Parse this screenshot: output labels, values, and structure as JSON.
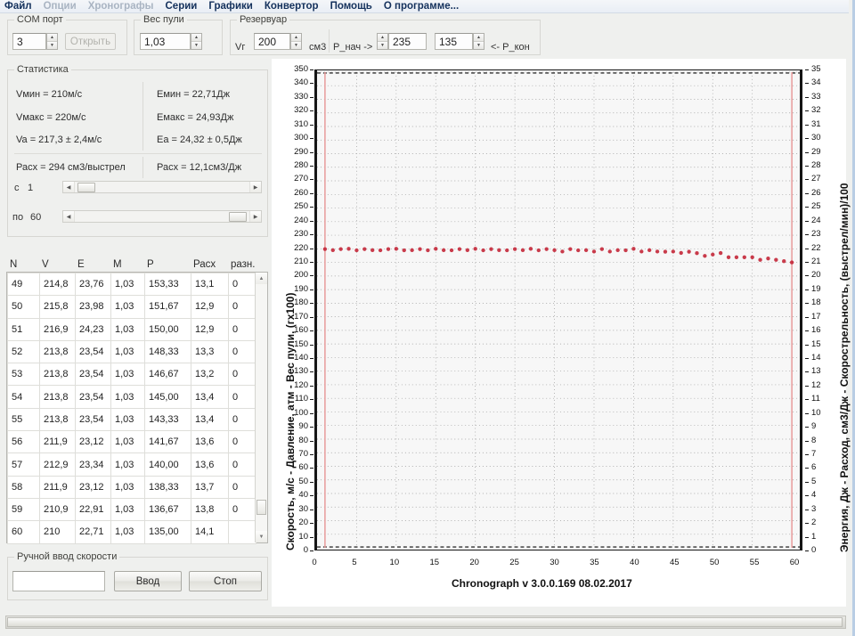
{
  "menu": {
    "items": [
      {
        "label": "Файл",
        "disabled": false
      },
      {
        "label": "Опции",
        "disabled": true
      },
      {
        "label": "Хронографы",
        "disabled": true
      },
      {
        "label": "Серии",
        "disabled": false
      },
      {
        "label": "Графики",
        "disabled": false
      },
      {
        "label": "Конвертор",
        "disabled": false
      },
      {
        "label": "Помощь",
        "disabled": false
      },
      {
        "label": "О программе...",
        "disabled": false
      }
    ]
  },
  "toolbar": {
    "com_group_label": "COM порт",
    "com_value": "3",
    "open_button": "Открыть",
    "bullet_group_label": "Вес пули",
    "bullet_value": "1,03",
    "reservoir_group_label": "Резервуар",
    "vg_label": "Vг",
    "vg_value": "200",
    "vg_units": "см3",
    "p_start_label": "P_нач ->",
    "p_start_value": "235",
    "p_end_value": "135",
    "p_end_label": "<- P_кон"
  },
  "statistics": {
    "group_label": "Статистика",
    "v_min": "Vмин = 210м/с",
    "v_max": "Vмакс = 220м/с",
    "v_avg": "Va = 217,3 ± 2,4м/с",
    "e_min": "Eмин = 22,71Дж",
    "e_max": "Eмакс = 24,93Дж",
    "e_avg": "Ea = 24,32 ± 0,5Дж",
    "rash_shot": "Расх = 294 см3/выстрел",
    "rash_joule": "Расх = 12,1см3/Дж",
    "from_label": "с",
    "from_value": "1",
    "to_label": "по",
    "to_value": "60"
  },
  "table": {
    "headers": [
      "N",
      "V",
      "E",
      "M",
      "P",
      "Расх",
      "разн."
    ],
    "rows": [
      [
        "49",
        "214,8",
        "23,76",
        "1,03",
        "153,33",
        "13,1",
        "0"
      ],
      [
        "50",
        "215,8",
        "23,98",
        "1,03",
        "151,67",
        "12,9",
        "0"
      ],
      [
        "51",
        "216,9",
        "24,23",
        "1,03",
        "150,00",
        "12,9",
        "0"
      ],
      [
        "52",
        "213,8",
        "23,54",
        "1,03",
        "148,33",
        "13,3",
        "0"
      ],
      [
        "53",
        "213,8",
        "23,54",
        "1,03",
        "146,67",
        "13,2",
        "0"
      ],
      [
        "54",
        "213,8",
        "23,54",
        "1,03",
        "145,00",
        "13,4",
        "0"
      ],
      [
        "55",
        "213,8",
        "23,54",
        "1,03",
        "143,33",
        "13,4",
        "0"
      ],
      [
        "56",
        "211,9",
        "23,12",
        "1,03",
        "141,67",
        "13,6",
        "0"
      ],
      [
        "57",
        "212,9",
        "23,34",
        "1,03",
        "140,00",
        "13,6",
        "0"
      ],
      [
        "58",
        "211,9",
        "23,12",
        "1,03",
        "138,33",
        "13,7",
        "0"
      ],
      [
        "59",
        "210,9",
        "22,91",
        "1,03",
        "136,67",
        "13,8",
        "0"
      ],
      [
        "60",
        "210",
        "22,71",
        "1,03",
        "135,00",
        "14,1",
        ""
      ]
    ]
  },
  "manual_input": {
    "group_label": "Ручной ввод скорости",
    "value": "",
    "enter_button": "Ввод",
    "stop_button": "Стоп"
  },
  "chart_data": {
    "type": "scatter",
    "title": "",
    "footer": "Chronograph v 3.0.0.169        08.02.2017",
    "xlabel": "",
    "ylabel": "Скорость, м/с - Давление, атм - Вес пули, (гх100)",
    "ylabel_right": "Энергия, Дж - Расход, см3/Дж - Скорострельность, (выстрел/мин)/100",
    "xlim": [
      0,
      61
    ],
    "ylim": [
      0,
      350
    ],
    "ylim_right": [
      0,
      35
    ],
    "xticks": [
      0,
      5,
      10,
      15,
      20,
      25,
      30,
      35,
      40,
      45,
      50,
      55,
      60
    ],
    "yticks": [
      0,
      10,
      20,
      30,
      40,
      50,
      60,
      70,
      80,
      90,
      100,
      110,
      120,
      130,
      140,
      150,
      160,
      170,
      180,
      190,
      200,
      210,
      220,
      230,
      240,
      250,
      260,
      270,
      280,
      290,
      300,
      310,
      320,
      330,
      340,
      350
    ],
    "yticks_right": [
      0,
      1,
      2,
      3,
      4,
      5,
      6,
      7,
      8,
      9,
      10,
      11,
      12,
      13,
      14,
      15,
      16,
      17,
      18,
      19,
      20,
      21,
      22,
      23,
      24,
      25,
      26,
      27,
      28,
      29,
      30,
      31,
      32,
      33,
      34,
      35
    ],
    "grid": true,
    "legend": "none",
    "marker_color": "#c42a3c",
    "vline_color": "#e8a0a0",
    "vlines": [
      1,
      60
    ],
    "series": [
      {
        "name": "Скорость, м/с",
        "color": "#c42a3c",
        "x": [
          1,
          2,
          3,
          4,
          5,
          6,
          7,
          8,
          9,
          10,
          11,
          12,
          13,
          14,
          15,
          16,
          17,
          18,
          19,
          20,
          21,
          22,
          23,
          24,
          25,
          26,
          27,
          28,
          29,
          30,
          31,
          32,
          33,
          34,
          35,
          36,
          37,
          38,
          39,
          40,
          41,
          42,
          43,
          44,
          45,
          46,
          47,
          48,
          49,
          50,
          51,
          52,
          53,
          54,
          55,
          56,
          57,
          58,
          59,
          60
        ],
        "y": [
          219.8,
          219.0,
          219.8,
          220.0,
          218.9,
          219.8,
          219.0,
          218.9,
          219.8,
          220.0,
          218.9,
          219.0,
          219.8,
          218.9,
          220.0,
          219.0,
          218.9,
          219.8,
          219.0,
          220.0,
          218.9,
          219.8,
          219.0,
          218.9,
          219.8,
          219.0,
          220.0,
          218.9,
          219.8,
          219.0,
          218.0,
          219.8,
          218.9,
          219.0,
          218.0,
          219.8,
          218.0,
          219.0,
          218.9,
          220.0,
          218.0,
          219.0,
          218.0,
          217.9,
          218.0,
          217.0,
          217.9,
          216.8,
          214.8,
          215.8,
          216.9,
          213.8,
          213.8,
          213.8,
          213.8,
          211.9,
          212.9,
          211.9,
          210.9,
          210.0
        ]
      }
    ]
  }
}
